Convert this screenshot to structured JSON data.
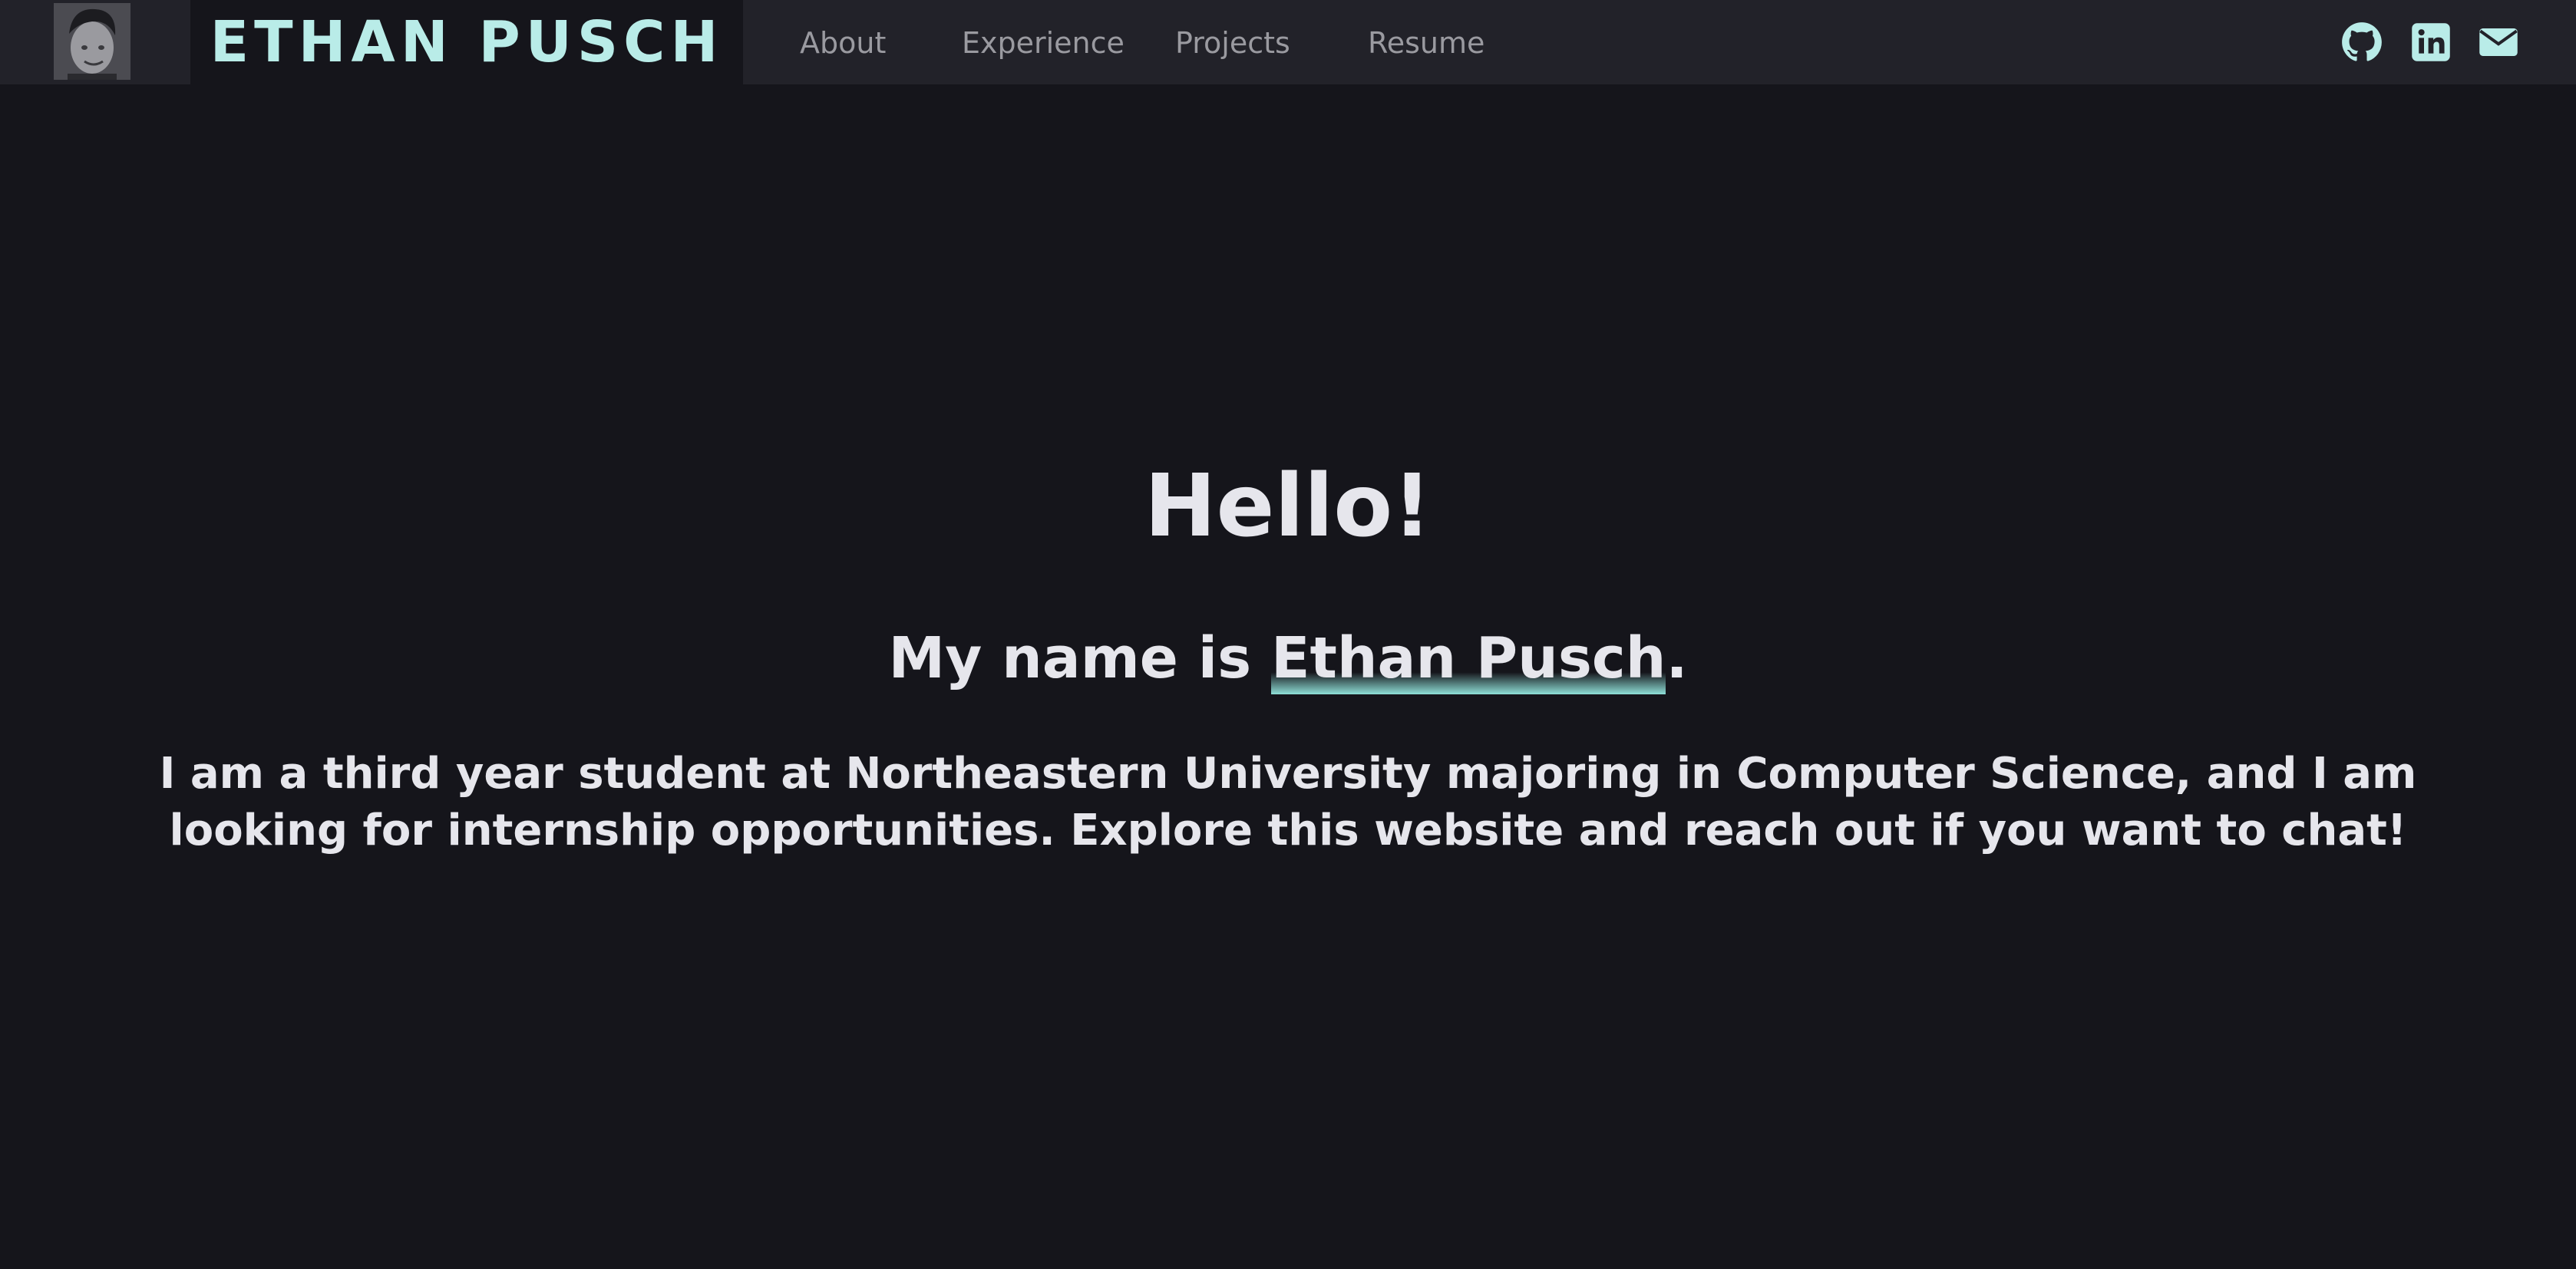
{
  "nav": {
    "brand": "ETHAN PUSCH",
    "links": [
      "About",
      "Experience",
      "Projects",
      "Resume"
    ],
    "social_icons": [
      "github-icon",
      "linkedin-icon",
      "email-icon"
    ]
  },
  "hero": {
    "greeting": "Hello!",
    "intro_prefix": "My name is ",
    "intro_name": "Ethan Pusch",
    "intro_suffix": ".",
    "bio_line1": "I am a third year student at Northeastern University majoring in Computer Science, and I am",
    "bio_line2": "looking for internship opportunities. Explore this website and reach out if you want to chat!"
  },
  "colors": {
    "background": "#15151b",
    "navbar": "#222229",
    "accent": "#b9ece8",
    "text": "#e6e6ec",
    "nav_text": "#9a9aa0"
  }
}
